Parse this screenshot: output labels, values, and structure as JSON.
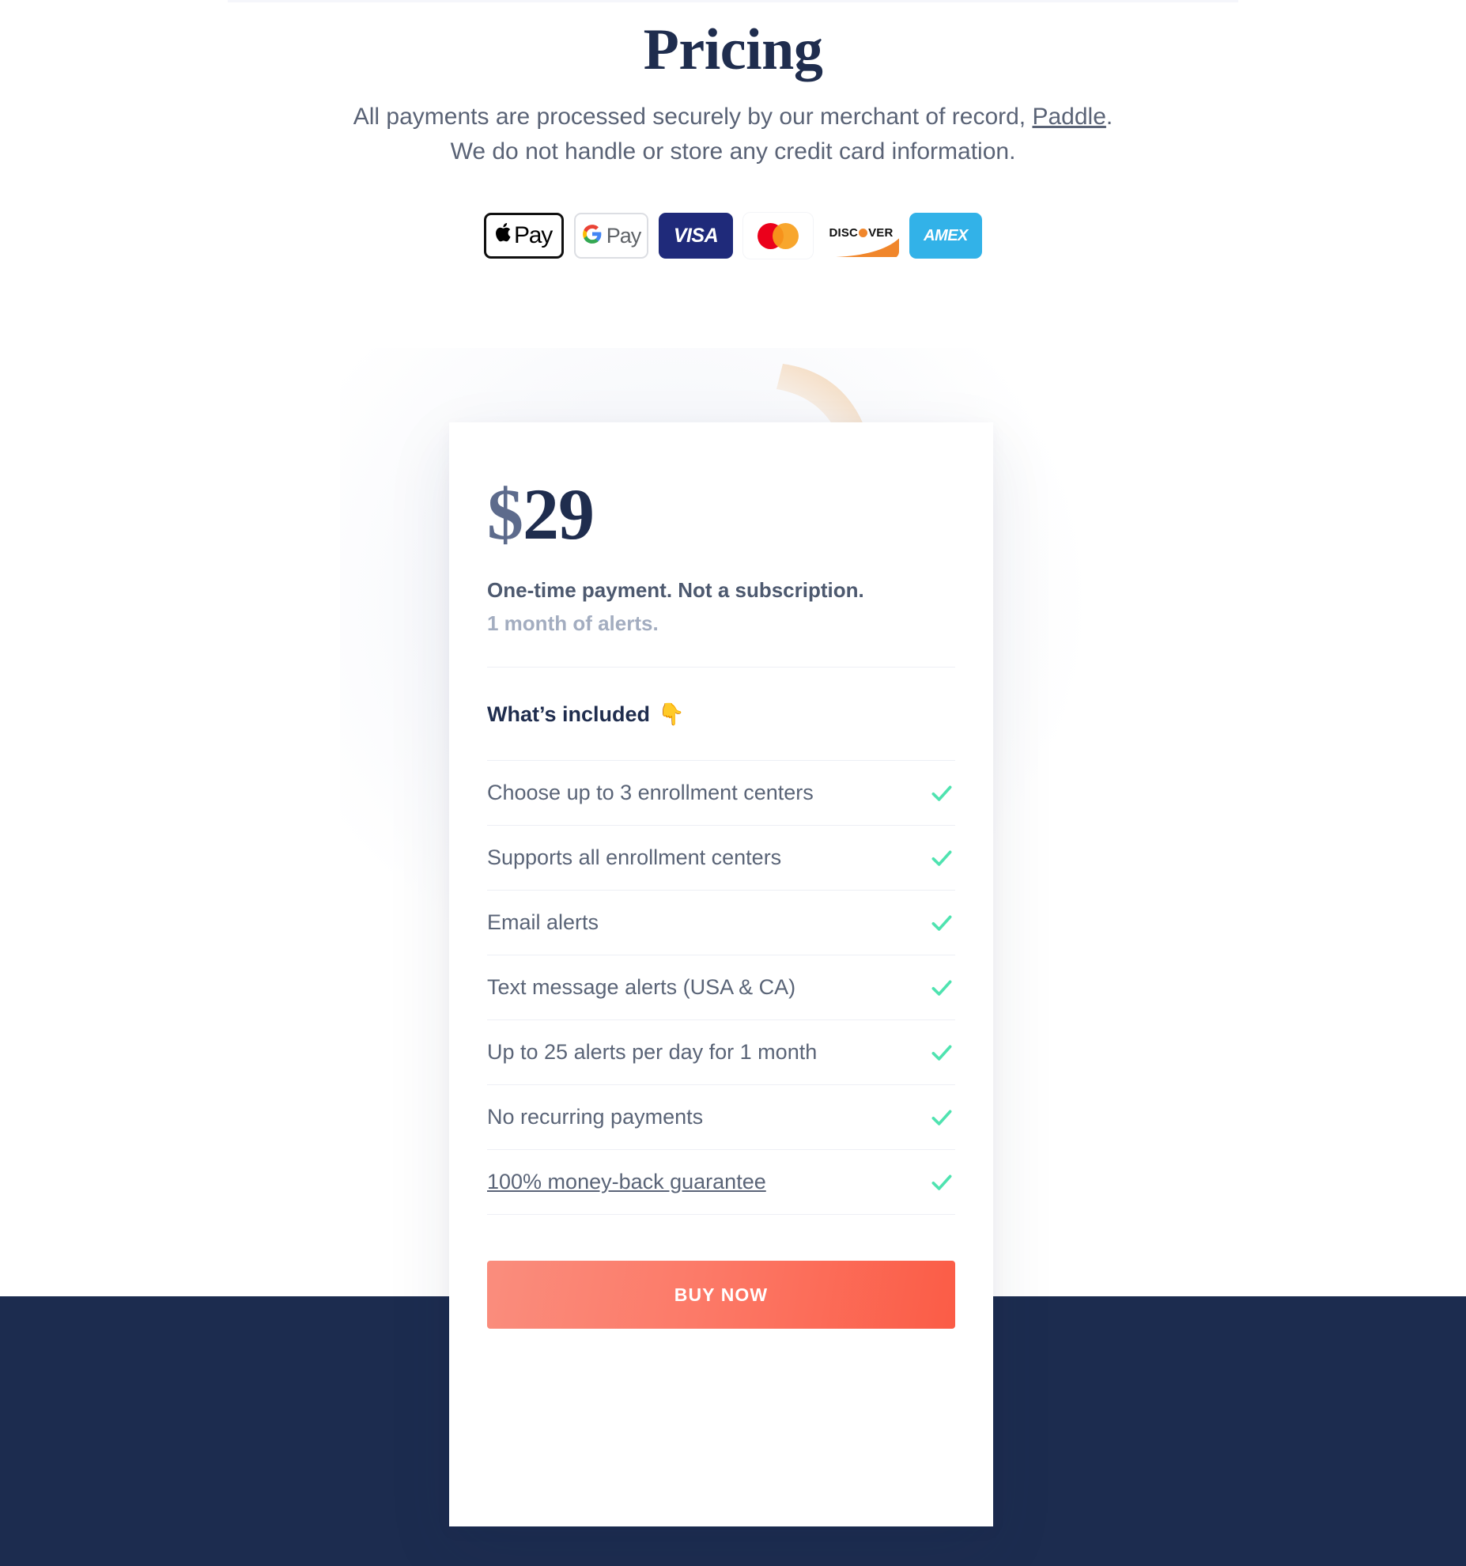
{
  "header": {
    "title": "Pricing",
    "subtitle_before": "All payments are processed securely by our merchant of record, ",
    "subtitle_link": "Paddle",
    "subtitle_after": ".",
    "subtitle_line2": "We do not handle or store any credit card information."
  },
  "payment_methods": [
    {
      "id": "apple-pay",
      "label": "Pay",
      "mark": ""
    },
    {
      "id": "google-pay",
      "label": "Pay",
      "mark": "G"
    },
    {
      "id": "visa",
      "label": "VISA"
    },
    {
      "id": "mastercard",
      "label": ""
    },
    {
      "id": "discover",
      "label_before": "DISC",
      "label_after": "VER"
    },
    {
      "id": "amex",
      "label": "AMEX"
    }
  ],
  "card": {
    "currency": "$",
    "amount": "29",
    "price_note": "One-time payment. Not a subscription.",
    "price_sub": "1 month of alerts.",
    "included_title": "What’s included",
    "included_emoji": "👇",
    "features": [
      {
        "label": "Choose up to 3 enrollment centers",
        "included": true,
        "is_link": false
      },
      {
        "label": "Supports all enrollment centers",
        "included": true,
        "is_link": false
      },
      {
        "label": "Email alerts",
        "included": true,
        "is_link": false
      },
      {
        "label": "Text message alerts (USA & CA)",
        "included": true,
        "is_link": false
      },
      {
        "label": "Up to 25 alerts per day for 1 month",
        "included": true,
        "is_link": false
      },
      {
        "label": "No recurring payments",
        "included": true,
        "is_link": false
      },
      {
        "label": "100% money-back guarantee",
        "included": true,
        "is_link": true
      }
    ],
    "buy_label": "BUY NOW"
  },
  "colors": {
    "title_navy": "#1f2d4e",
    "body_gray": "#5a6477",
    "muted_gray": "#a3adc0",
    "check_green": "#4fe3b0",
    "footer_navy": "#1c2c4f",
    "cta_gradient_from": "#fa8d7d",
    "cta_gradient_to": "#fb5c46",
    "visa_blue": "#1f2a7a",
    "amex_blue": "#32b2e8",
    "discover_orange": "#f0862b",
    "decor_orange": "#efab5e",
    "decor_blue": "#6ec8ec"
  }
}
